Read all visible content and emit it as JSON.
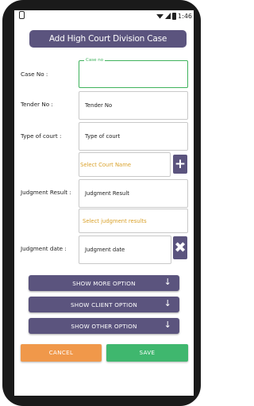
{
  "status_bar": {
    "time": "1:46",
    "icons": [
      "wifi-icon",
      "signal-icon",
      "battery-icon"
    ]
  },
  "header": {
    "title": "Add High Court Division Case"
  },
  "form": {
    "case_no": {
      "label": "Case No :",
      "floating_label": "Case no",
      "value": ""
    },
    "tender_no": {
      "label": "Tender No :",
      "placeholder": "Tender No"
    },
    "type_of_court": {
      "label": "Type of court :",
      "placeholder": "Type of court",
      "select_placeholder": "Select Court Name",
      "add_icon": "plus-icon"
    },
    "judgment_result": {
      "label": "Judgment Result :",
      "placeholder": "Judgment Result",
      "select_placeholder": "Select judgment results"
    },
    "judgment_date": {
      "label": "Judgment date :",
      "placeholder": "Judgment date",
      "clear_icon": "close-icon"
    }
  },
  "options": {
    "show_more": "SHOW MORE OPTION",
    "show_client": "SHOW CLIENT OPTION",
    "show_other": "SHOW OTHER OPTION"
  },
  "actions": {
    "cancel": "CANCEL",
    "save": "SAVE"
  },
  "colors": {
    "primary": "#5b547e",
    "cancel": "#f0984a",
    "save": "#3fb76e",
    "focus": "#3fb25c",
    "select_text": "#d9a12a"
  }
}
